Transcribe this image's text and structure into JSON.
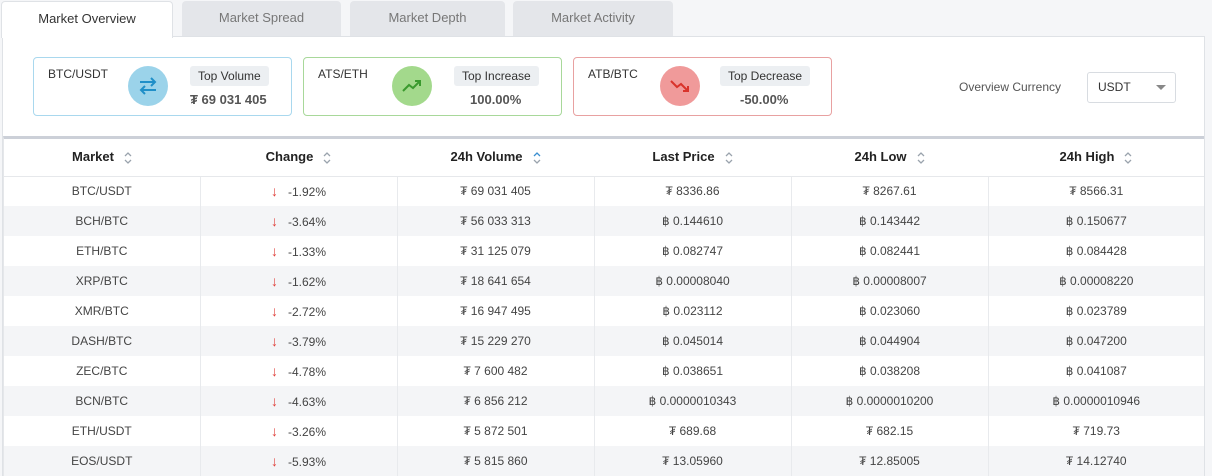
{
  "tabs": [
    {
      "label": "Market Overview",
      "active": true
    },
    {
      "label": "Market Spread",
      "active": false
    },
    {
      "label": "Market Depth",
      "active": false
    },
    {
      "label": "Market Activity",
      "active": false
    }
  ],
  "cards": {
    "top_volume": {
      "market": "BTC/USDT",
      "badge": "Top Volume",
      "value": "₮ 69 031 405",
      "color": "#9bd3ea",
      "icon": "swap-icon"
    },
    "top_increase": {
      "market": "ATS/ETH",
      "badge": "Top Increase",
      "value": "100.00%",
      "color": "#a3d98c",
      "icon": "trend-up-icon"
    },
    "top_decrease": {
      "market": "ATB/BTC",
      "badge": "Top Decrease",
      "value": "-50.00%",
      "color": "#f09a9a",
      "icon": "trend-down-icon"
    }
  },
  "overview_currency": {
    "label": "Overview Currency",
    "selected": "USDT"
  },
  "table": {
    "headers": [
      "Market",
      "Change",
      "24h Volume",
      "Last Price",
      "24h Low",
      "24h High"
    ],
    "rows": [
      [
        "BTC/USDT",
        "-1.92%",
        "₮ 69 031 405",
        "₮ 8336.86",
        "₮ 8267.61",
        "₮ 8566.31"
      ],
      [
        "BCH/BTC",
        "-3.64%",
        "₮ 56 033 313",
        "฿ 0.144610",
        "฿ 0.143442",
        "฿ 0.150677"
      ],
      [
        "ETH/BTC",
        "-1.33%",
        "₮ 31 125 079",
        "฿ 0.082747",
        "฿ 0.082441",
        "฿ 0.084428"
      ],
      [
        "XRP/BTC",
        "-1.62%",
        "₮ 18 641 654",
        "฿ 0.00008040",
        "฿ 0.00008007",
        "฿ 0.00008220"
      ],
      [
        "XMR/BTC",
        "-2.72%",
        "₮ 16 947 495",
        "฿ 0.023112",
        "฿ 0.023060",
        "฿ 0.023789"
      ],
      [
        "DASH/BTC",
        "-3.79%",
        "₮ 15 229 270",
        "฿ 0.045014",
        "฿ 0.044904",
        "฿ 0.047200"
      ],
      [
        "ZEC/BTC",
        "-4.78%",
        "₮ 7 600 482",
        "฿ 0.038651",
        "฿ 0.038208",
        "฿ 0.041087"
      ],
      [
        "BCN/BTC",
        "-4.63%",
        "₮ 6 856 212",
        "฿ 0.0000010343",
        "฿ 0.0000010200",
        "฿ 0.0000010946"
      ],
      [
        "ETH/USDT",
        "-3.26%",
        "₮ 5 872 501",
        "₮ 689.68",
        "₮ 682.15",
        "₮ 719.73"
      ],
      [
        "EOS/USDT",
        "-5.93%",
        "₮ 5 815 860",
        "₮ 13.05960",
        "₮ 12.85005",
        "₮ 14.12740"
      ]
    ]
  }
}
